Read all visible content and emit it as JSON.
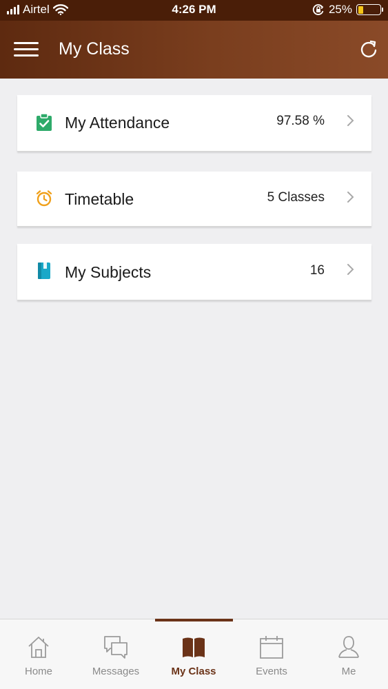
{
  "status_bar": {
    "carrier": "Airtel",
    "time": "4:26 PM",
    "battery_percent": "25%",
    "battery_level": 0.25
  },
  "header": {
    "title": "My Class"
  },
  "cards": [
    {
      "label": "My Attendance",
      "value": "97.58 %",
      "icon": "clipboard-check-icon",
      "icon_color": "#2eaa6a"
    },
    {
      "label": "Timetable",
      "value": "5 Classes",
      "icon": "alarm-clock-icon",
      "icon_color": "#f0a01a"
    },
    {
      "label": "My Subjects",
      "value": "16",
      "icon": "book-icon",
      "icon_color": "#19a8c8"
    }
  ],
  "bottom_nav": {
    "items": [
      {
        "label": "Home",
        "icon": "home-icon"
      },
      {
        "label": "Messages",
        "icon": "messages-icon"
      },
      {
        "label": "My Class",
        "icon": "open-book-icon"
      },
      {
        "label": "Events",
        "icon": "calendar-icon"
      },
      {
        "label": "Me",
        "icon": "user-icon"
      }
    ],
    "active_index": 2
  },
  "colors": {
    "header_brown": "#6b3318",
    "status_bar": "#4a1e08",
    "background": "#efeff1"
  }
}
